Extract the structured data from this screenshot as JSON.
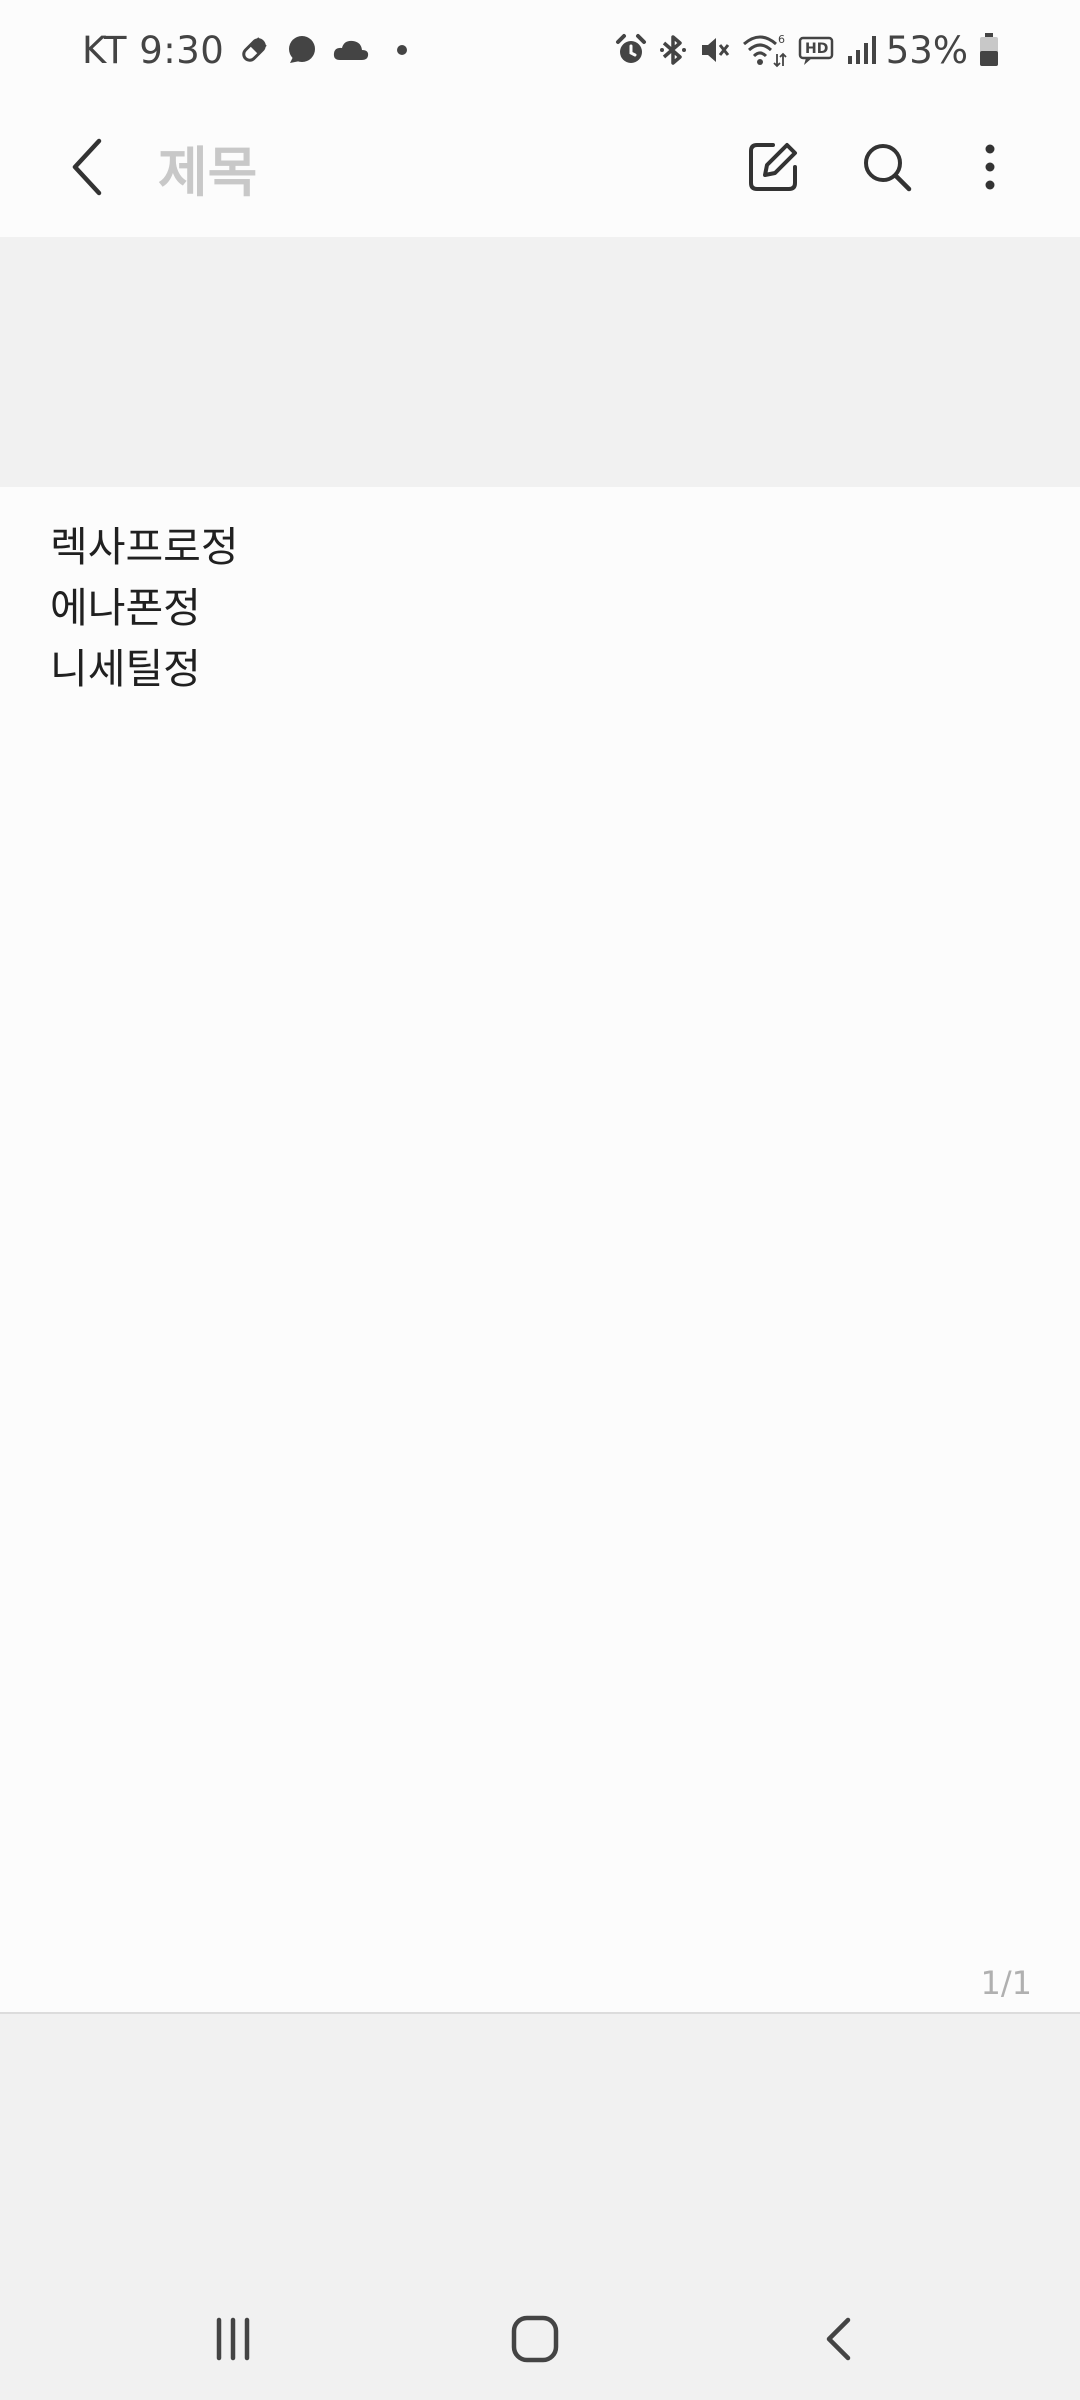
{
  "status_bar": {
    "carrier_time": "KT 9:30",
    "battery": "53%",
    "icons_left": [
      "pill-icon",
      "chat-bubble-icon",
      "cloud-icon",
      "dot-icon"
    ],
    "icons_right": [
      "alarm-icon",
      "bluetooth-icon",
      "mute-icon",
      "wifi-icon",
      "hd-voice-icon",
      "signal-icon",
      "battery-icon"
    ],
    "wifi_badge": "6",
    "hd_badge": "HD"
  },
  "app_bar": {
    "title_placeholder": "제목",
    "icons": [
      "back-arrow-icon",
      "edit-icon",
      "search-icon",
      "more-vertical-icon"
    ]
  },
  "note": {
    "lines": [
      "렉사프로정",
      "에나폰정",
      "니세틸정"
    ],
    "page_indicator": "1/1"
  },
  "nav_bar": {
    "icons": [
      "recents-icon",
      "home-icon",
      "back-icon"
    ]
  },
  "colors": {
    "background": "#fcfcfc",
    "band": "#f1f1f1",
    "placeholder": "#c8c8c8",
    "text": "#202020"
  }
}
